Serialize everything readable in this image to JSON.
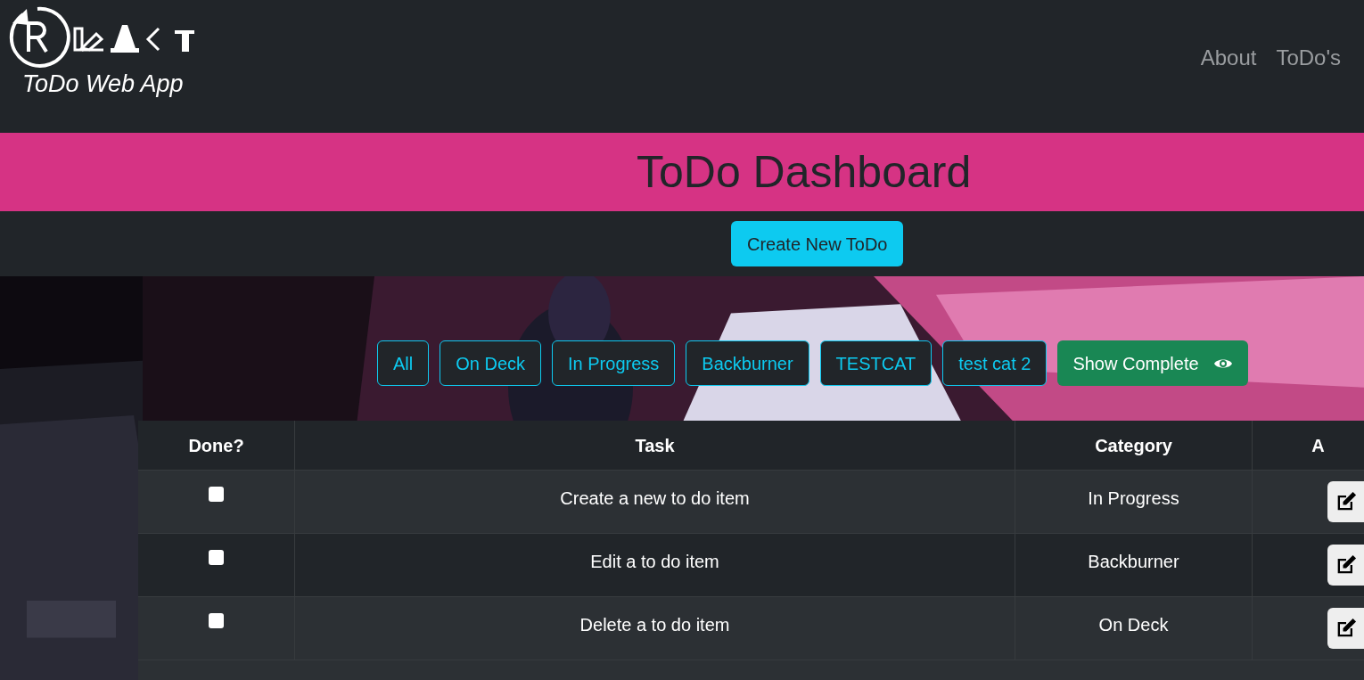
{
  "brand": {
    "subtitle": "ToDo Web App"
  },
  "nav": [
    {
      "label": "About"
    },
    {
      "label": "ToDo's"
    }
  ],
  "banner": {
    "title": "ToDo Dashboard"
  },
  "create_button": "Create New ToDo",
  "filters": [
    {
      "label": "All"
    },
    {
      "label": "On Deck"
    },
    {
      "label": "In Progress"
    },
    {
      "label": "Backburner"
    },
    {
      "label": "TESTCAT"
    },
    {
      "label": "test cat 2"
    }
  ],
  "show_complete": "Show Complete",
  "table": {
    "columns": [
      "Done?",
      "Task",
      "Category",
      "A"
    ],
    "rows": [
      {
        "done": false,
        "task": "Create a new to do item",
        "category": "In Progress"
      },
      {
        "done": false,
        "task": "Edit a to do item",
        "category": "Backburner"
      },
      {
        "done": false,
        "task": "Delete a to do item",
        "category": "On Deck"
      }
    ]
  }
}
